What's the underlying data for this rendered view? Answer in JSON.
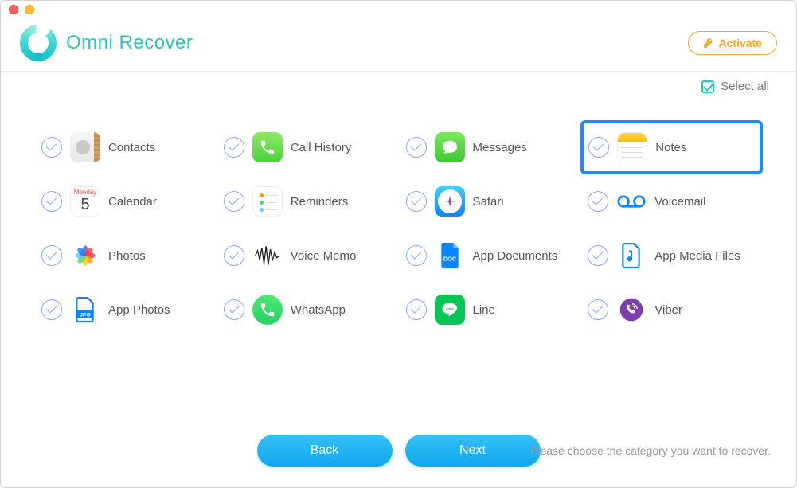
{
  "app": {
    "title": "Omni Recover"
  },
  "header": {
    "activate": "Activate"
  },
  "toolbar": {
    "selectAll": "Select all"
  },
  "calendar": {
    "day": "Monday",
    "num": "5"
  },
  "items": [
    {
      "id": "contacts",
      "label": "Contacts"
    },
    {
      "id": "callhistory",
      "label": "Call History"
    },
    {
      "id": "messages",
      "label": "Messages"
    },
    {
      "id": "notes",
      "label": "Notes",
      "highlight": true
    },
    {
      "id": "calendar",
      "label": "Calendar"
    },
    {
      "id": "reminders",
      "label": "Reminders"
    },
    {
      "id": "safari",
      "label": "Safari"
    },
    {
      "id": "voicemail",
      "label": "Voicemail"
    },
    {
      "id": "photos",
      "label": "Photos"
    },
    {
      "id": "voicememo",
      "label": "Voice Memo"
    },
    {
      "id": "appdocs",
      "label": "App Documents"
    },
    {
      "id": "appmedia",
      "label": "App Media Files"
    },
    {
      "id": "appphotos",
      "label": "App Photos"
    },
    {
      "id": "whatsapp",
      "label": "WhatsApp"
    },
    {
      "id": "line",
      "label": "Line"
    },
    {
      "id": "viber",
      "label": "Viber"
    }
  ],
  "footer": {
    "back": "Back",
    "next": "Next",
    "hint": "Please choose the category you want to recover."
  }
}
